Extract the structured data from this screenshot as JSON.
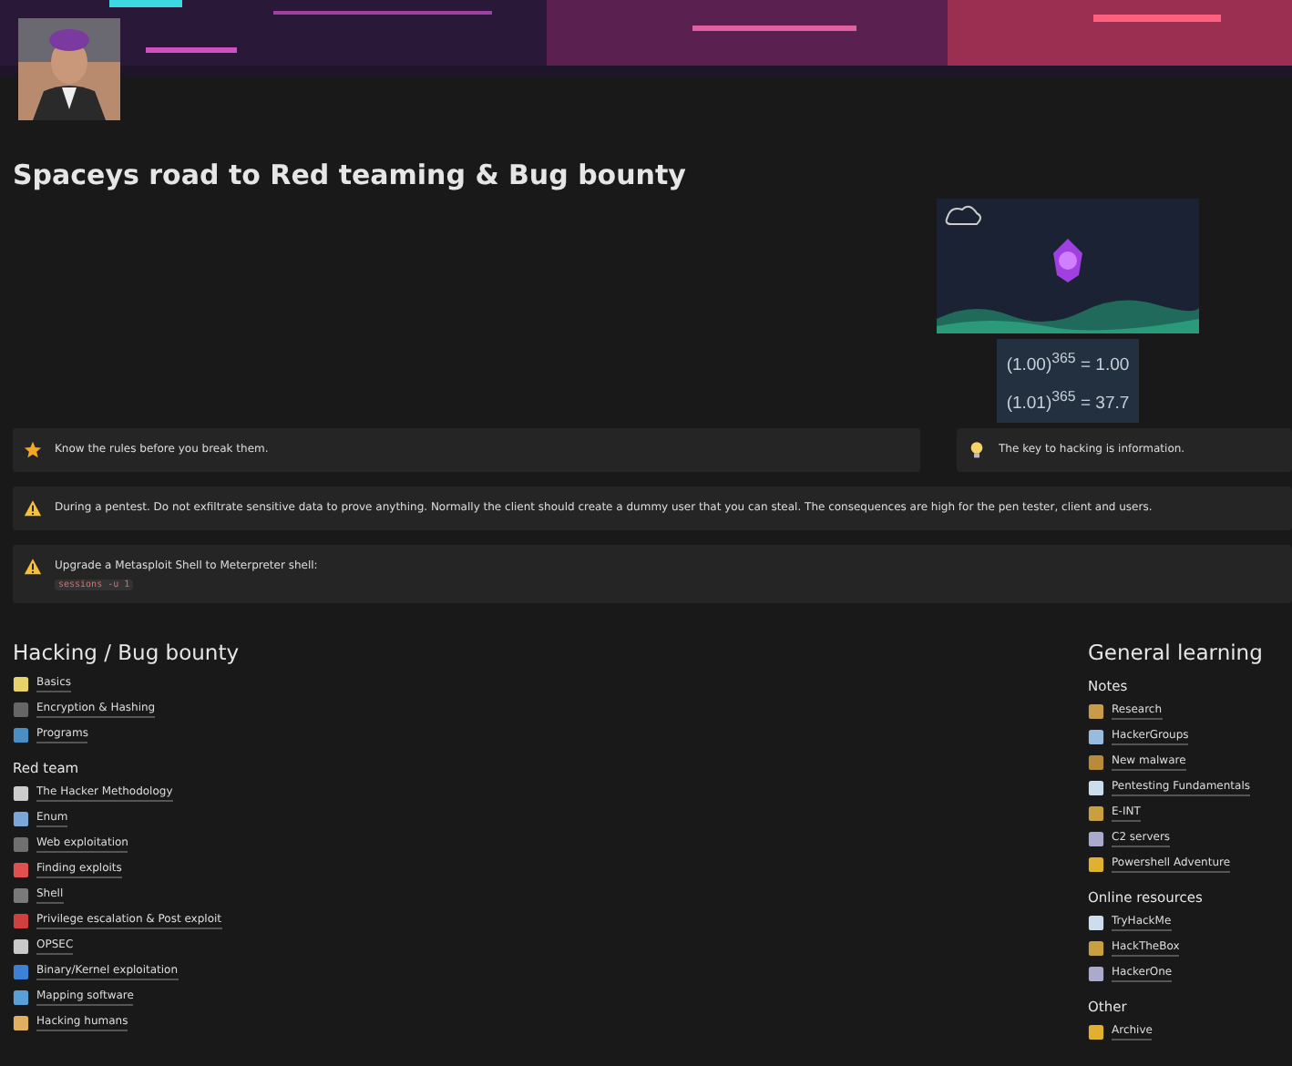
{
  "page": {
    "title": "Spaceys road to Red teaming & Bug bounty"
  },
  "formula": {
    "lines": [
      "(1.00)$^{365}$ = 1.00",
      "(1.01)$^{365}$ = 37.7"
    ]
  },
  "callout_row": [
    {
      "kind": "star",
      "text": "Know the rules before you break them."
    },
    {
      "kind": "bulb",
      "text": "The key to hacking is information."
    }
  ],
  "callouts": [
    {
      "kind": "warning",
      "text": "During a pentest. Do not exfiltrate sensitive data to prove anything. Normally the client should create a dummy user that you can steal. The consequences are high for the pen tester, client and users."
    },
    {
      "kind": "warning",
      "text": "Upgrade a Metasploit Shell to Meterpreter shell:",
      "code": "sessions -u 1"
    }
  ],
  "left": {
    "heading": "Hacking / Bug bounty",
    "groups": [
      {
        "items": [
          "Basics",
          "Encryption & Hashing",
          "Programs"
        ]
      },
      {
        "title": "Red team",
        "items": [
          "The Hacker Methodology",
          "Enum",
          "Web exploitation",
          "Finding exploits",
          "Shell",
          "Privilege escalation & Post exploit",
          "OPSEC",
          "Binary/Kernel exploitation",
          "Mapping software",
          "Hacking humans"
        ]
      }
    ]
  },
  "right": {
    "heading": "General learning",
    "groups": [
      {
        "title": "Notes",
        "items": [
          "Research",
          "HackerGroups",
          "New malware",
          "Pentesting Fundamentals",
          "E-INT",
          "C2 servers",
          "Powershell Adventure"
        ]
      },
      {
        "title": "Online resources",
        "items": [
          "TryHackMe",
          "HackTheBox",
          "HackerOne"
        ]
      },
      {
        "title": "Other",
        "items": [
          "Archive"
        ]
      }
    ]
  }
}
